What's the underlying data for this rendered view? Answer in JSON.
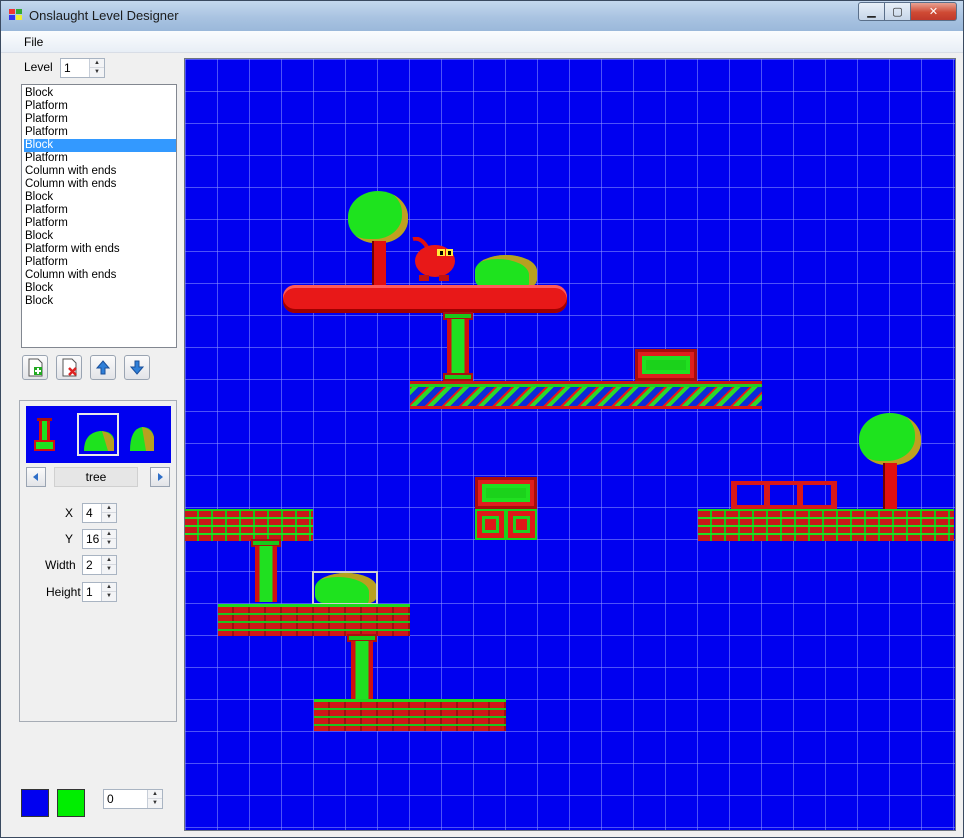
{
  "window": {
    "title": "Onslaught Level Designer"
  },
  "caption": {
    "minimize": "▁",
    "maximize": "▢",
    "close": "✕"
  },
  "menu": {
    "file": "File"
  },
  "level": {
    "label": "Level",
    "value": "1"
  },
  "object_list": {
    "selected_index": 4,
    "items": [
      "Block",
      "Platform",
      "Platform",
      "Platform",
      "Block",
      "Platform",
      "Column with ends",
      "Column with ends",
      "Block",
      "Platform",
      "Platform",
      "Block",
      "Platform with ends",
      "Platform",
      "Column with ends",
      "Block",
      "Block"
    ]
  },
  "toolbar_icons": [
    "add-object-icon",
    "delete-object-icon",
    "move-up-icon",
    "move-down-icon"
  ],
  "tile_selector": {
    "current": "tree",
    "selected_index": 1
  },
  "properties": {
    "x": {
      "label": "X",
      "value": "4"
    },
    "y": {
      "label": "Y",
      "value": "16"
    },
    "width": {
      "label": "Width",
      "value": "2"
    },
    "height": {
      "label": "Height",
      "value": "1"
    }
  },
  "colors": {
    "background": "#0000f0",
    "foreground": "#00ee00",
    "brick_red": "#c81818",
    "highlight": "#3399ff"
  },
  "color_index": {
    "value": "0"
  }
}
